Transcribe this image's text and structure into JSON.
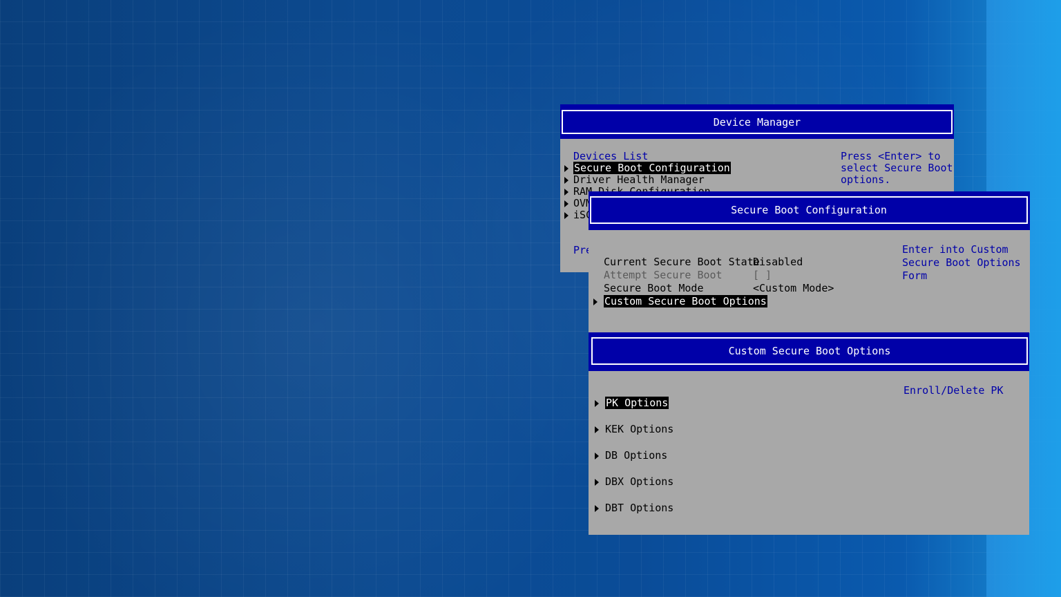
{
  "device_manager": {
    "title": "Device Manager",
    "list_header": "Devices List",
    "items": [
      {
        "label": "Secure Boot Configuration",
        "selected": true
      },
      {
        "label": "Driver Health Manager"
      },
      {
        "label": "RAM Disk Configuration"
      },
      {
        "label": "OVM"
      },
      {
        "label": "iSC"
      }
    ],
    "footer_partial": "Pre",
    "help": [
      "Press <Enter> to",
      "select Secure Boot",
      "options."
    ]
  },
  "secure_boot_config": {
    "title": "Secure Boot Configuration",
    "rows": [
      {
        "label": "Current Secure Boot State",
        "value": "Disabled"
      },
      {
        "label": "Attempt Secure Boot",
        "value": "[ ]"
      },
      {
        "label": "Secure Boot Mode",
        "value": "<Custom Mode>"
      }
    ],
    "submenu": "Custom Secure Boot Options",
    "help": [
      "Enter into Custom",
      "Secure Boot Options",
      "Form"
    ]
  },
  "custom_options": {
    "title": "Custom Secure Boot Options",
    "items": [
      "PK Options",
      "KEK Options",
      "DB Options",
      "DBX Options",
      "DBT Options"
    ],
    "help": "Enroll/Delete PK"
  },
  "colors": {
    "title_blue": "#0000a8",
    "panel_gray": "#a8a8a8",
    "help_text": "#0000a8"
  }
}
